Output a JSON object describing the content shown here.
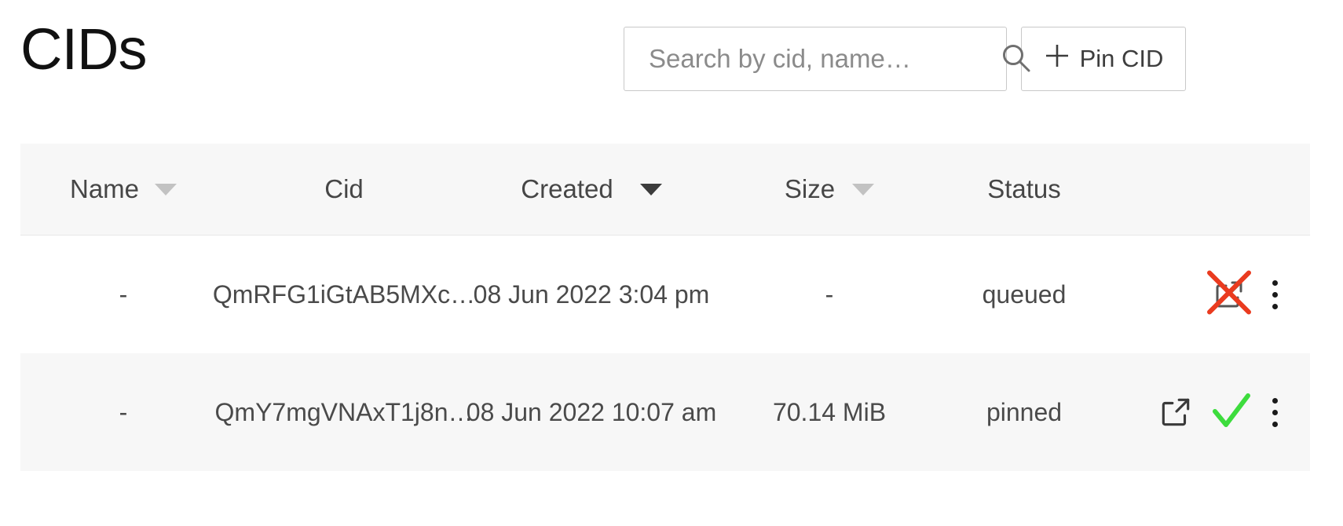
{
  "page": {
    "title": "CIDs"
  },
  "search": {
    "value": "",
    "placeholder": "Search by cid, name…",
    "icon": "search-icon"
  },
  "pin_button": {
    "label": "Pin CID",
    "icon": "plus-icon"
  },
  "table": {
    "columns": [
      {
        "key": "name",
        "label": "Name",
        "sortable": true,
        "sort_active": false
      },
      {
        "key": "cid",
        "label": "Cid",
        "sortable": false,
        "sort_active": false
      },
      {
        "key": "created",
        "label": "Created",
        "sortable": true,
        "sort_active": true
      },
      {
        "key": "size",
        "label": "Size",
        "sortable": true,
        "sort_active": false
      },
      {
        "key": "status",
        "label": "Status",
        "sortable": false,
        "sort_active": false
      }
    ],
    "rows": [
      {
        "name": "-",
        "cid": "QmRFG1iGtAB5MXc…",
        "created": "08 Jun 2022 3:04 pm",
        "size": "-",
        "status": "queued",
        "icons": [
          "external-link-icon-crossed",
          "kebab-menu-icon"
        ]
      },
      {
        "name": "-",
        "cid": "QmY7mgVNAxT1j8n…",
        "created": "08 Jun 2022 10:07 am",
        "size": "70.14 MiB",
        "status": "pinned",
        "icons": [
          "external-link-icon",
          "check-icon",
          "kebab-menu-icon"
        ]
      }
    ]
  },
  "colors": {
    "header_bg": "#f7f7f7",
    "row_shade_bg": "#f7f7f7",
    "border": "#e8e8e8",
    "text": "#4a4a4a",
    "cross_red": "#ea3b1f",
    "check_green": "#3ddc3d",
    "caret_inactive": "#c2c2c2",
    "caret_active": "#3c3c3c"
  }
}
